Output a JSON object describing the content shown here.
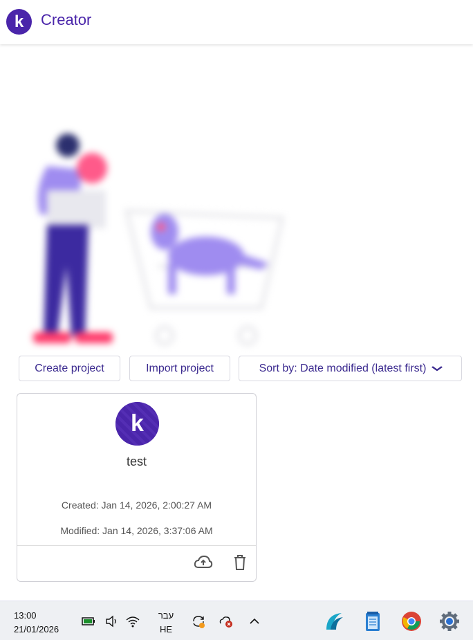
{
  "header": {
    "logo_letter": "k",
    "title": "Creator"
  },
  "toolbar": {
    "create_label": "Create project",
    "import_label": "Import project",
    "sort_label": "Sort by: Date modified (latest first)"
  },
  "projects": [
    {
      "avatar_letter": "k",
      "name": "test",
      "created": "Created: Jan 14, 2026, 2:00:27 AM",
      "modified": "Modified: Jan 14, 2026, 3:37:06 AM"
    }
  ],
  "taskbar": {
    "time": "13:00",
    "date": "21/01/2026",
    "lang_top": "עבר",
    "lang_bottom": "HE",
    "icons": [
      "battery-icon",
      "speaker-icon",
      "wifi-icon",
      "sync-icon",
      "onedrive-error-icon",
      "chevron-up-icon"
    ],
    "apps": [
      "app-wave-icon",
      "notepad-icon",
      "chrome-icon",
      "settings-icon"
    ]
  }
}
